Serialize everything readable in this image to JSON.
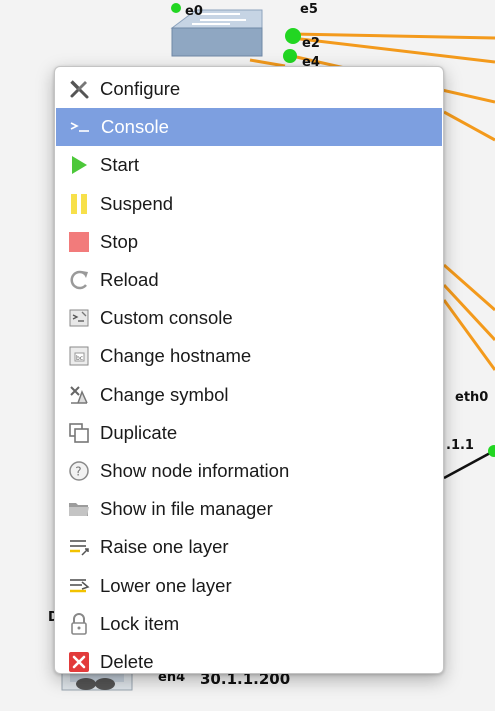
{
  "topology": {
    "labels": {
      "e0": "e0",
      "e5": "e5",
      "e2": "e2",
      "e4": "e4",
      "eth0": "eth0",
      "ip_partial": ".1.1",
      "de": "De",
      "en4": "en4",
      "ip_full": "30.1.1.200"
    },
    "link_color": "#f39a1c",
    "port_color": "#22d622"
  },
  "context_menu": {
    "highlight_color": "#7d9fe0",
    "items": [
      {
        "label": "Configure",
        "icon": "tools-icon"
      },
      {
        "label": "Console",
        "icon": "terminal-prompt-icon",
        "highlighted": true
      },
      {
        "label": "Start",
        "icon": "play-icon"
      },
      {
        "label": "Suspend",
        "icon": "pause-icon"
      },
      {
        "label": "Stop",
        "icon": "stop-icon"
      },
      {
        "label": "Reload",
        "icon": "reload-icon"
      },
      {
        "label": "Custom console",
        "icon": "custom-console-icon"
      },
      {
        "label": "Change hostname",
        "icon": "hostname-icon"
      },
      {
        "label": "Change symbol",
        "icon": "symbol-icon"
      },
      {
        "label": "Duplicate",
        "icon": "duplicate-icon"
      },
      {
        "label": "Show node information",
        "icon": "info-icon"
      },
      {
        "label": "Show in file manager",
        "icon": "folder-icon"
      },
      {
        "label": "Raise one layer",
        "icon": "raise-layer-icon"
      },
      {
        "label": "Lower one layer",
        "icon": "lower-layer-icon"
      },
      {
        "label": "Lock item",
        "icon": "lock-icon"
      },
      {
        "label": "Delete",
        "icon": "delete-icon"
      }
    ]
  }
}
